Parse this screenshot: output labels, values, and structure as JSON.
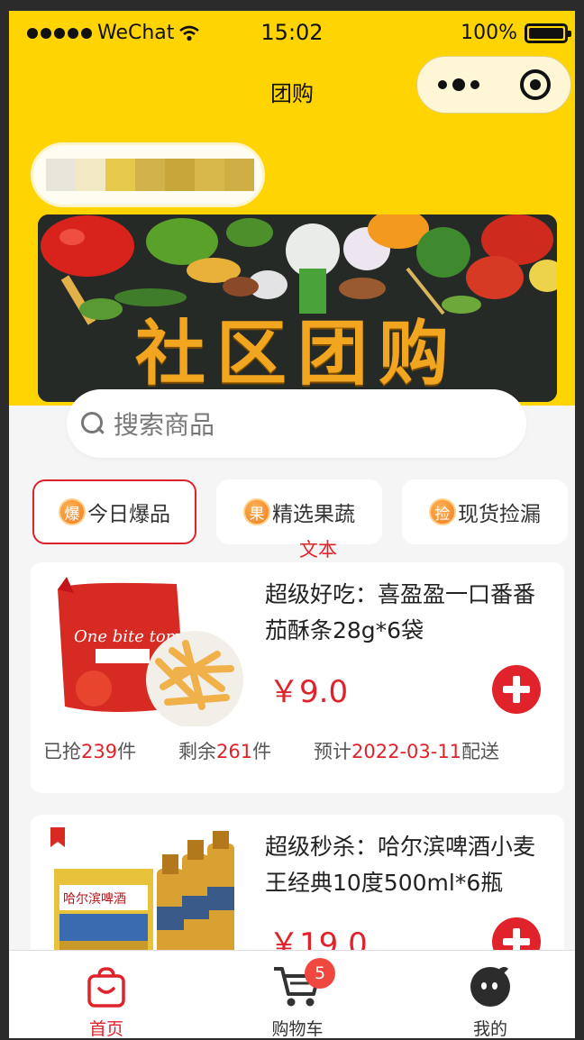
{
  "status_bar": {
    "carrier": "WeChat",
    "time": "15:02",
    "battery": "100%"
  },
  "nav": {
    "title": "团购"
  },
  "location": {
    "text": ""
  },
  "banner": {
    "title": "社区团购"
  },
  "search": {
    "placeholder": "搜索商品"
  },
  "categories": [
    {
      "badge": "爆",
      "label": "今日爆品",
      "active": true
    },
    {
      "badge": "果",
      "label": "精选果蔬",
      "active": false
    },
    {
      "badge": "捡",
      "label": "现货捡漏",
      "active": false
    }
  ],
  "category_subtext": "文本",
  "products": [
    {
      "title": "超级好吃：喜盈盈一口番番茄酥条28g*6袋",
      "price": "￥9.0",
      "sold_prefix": "已抢",
      "sold": "239",
      "sold_suffix": "件",
      "left_prefix": "剩余",
      "left": "261",
      "left_suffix": "件",
      "delivery_prefix": "预计",
      "delivery_date": "2022-03-11",
      "delivery_suffix": "配送",
      "image_text": "One bite tomato"
    },
    {
      "title": "超级秒杀：哈尔滨啤酒小麦王经典10度500ml*6瓶",
      "price": "￥19.0",
      "image_text": "哈尔滨啤酒"
    }
  ],
  "tabbar": [
    {
      "label": "首页",
      "icon": "bag-icon",
      "active": true
    },
    {
      "label": "购物车",
      "icon": "cart-icon",
      "badge": "5",
      "active": false
    },
    {
      "label": "我的",
      "icon": "profile-icon",
      "active": false
    }
  ],
  "colors": {
    "brand_yellow": "#ffd400",
    "accent_red": "#e0222a"
  }
}
